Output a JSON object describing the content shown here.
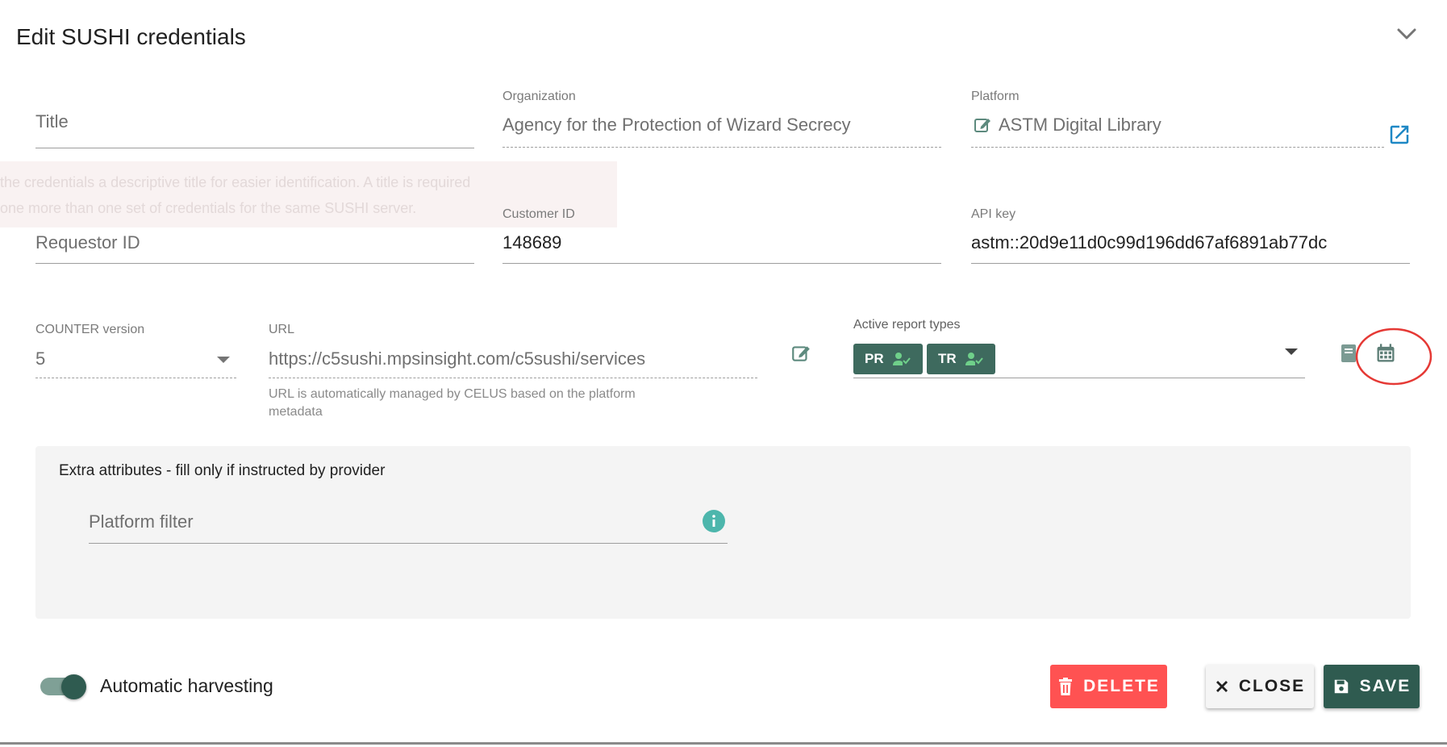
{
  "dialog": {
    "title": "Edit SUSHI credentials"
  },
  "fields": {
    "title": {
      "placeholder": "Title"
    },
    "organization": {
      "label": "Organization",
      "value": "Agency for the Protection of Wizard Secrecy"
    },
    "platform": {
      "label": "Platform",
      "value": "ASTM Digital Library"
    },
    "requestor_id": {
      "placeholder": "Requestor ID"
    },
    "customer_id": {
      "label": "Customer ID",
      "value": "148689"
    },
    "api_key": {
      "label": "API key",
      "value": "astm::20d9e11d0c99d196dd67af6891ab77dc"
    },
    "counter_version": {
      "label": "COUNTER version",
      "value": "5"
    },
    "url": {
      "label": "URL",
      "value": "https://c5sushi.mpsinsight.com/c5sushi/services",
      "hint_line1": "URL is automatically managed by CELUS based on the platform",
      "hint_line2": "metadata"
    },
    "report_types": {
      "label": "Active report types",
      "chips": [
        "PR",
        "TR"
      ]
    }
  },
  "tooltip": {
    "line1": "the credentials a descriptive title for easier identification. A title is required",
    "line2": "one more than one set of credentials for the same SUSHI server."
  },
  "extra": {
    "title": "Extra attributes - fill only if instructed by provider",
    "platform_filter_placeholder": "Platform filter"
  },
  "footer": {
    "automatic_harvesting_label": "Automatic harvesting",
    "automatic_harvesting_on": true,
    "delete_label": "DELETE",
    "close_label": "CLOSE",
    "save_label": "SAVE"
  },
  "colors": {
    "primary": "#2f5b50",
    "chip": "#3e6a5e",
    "danger": "#ff5252",
    "info": "#4db6ac",
    "annotation": "#e53935",
    "link": "#1e88e5"
  },
  "icons": {
    "collapse": "chevron-down-icon",
    "platform_edit": "pencil-box-icon",
    "open_external": "open-in-new-icon",
    "url_edit": "pencil-box-icon",
    "report_chip": "account-check-icon",
    "report_dropdown": "caret-down-icon",
    "report_list": "book-icon",
    "report_calendar": "calendar-icon",
    "info": "info-icon",
    "delete": "trash-icon",
    "close": "close-icon",
    "save": "floppy-disk-icon"
  }
}
